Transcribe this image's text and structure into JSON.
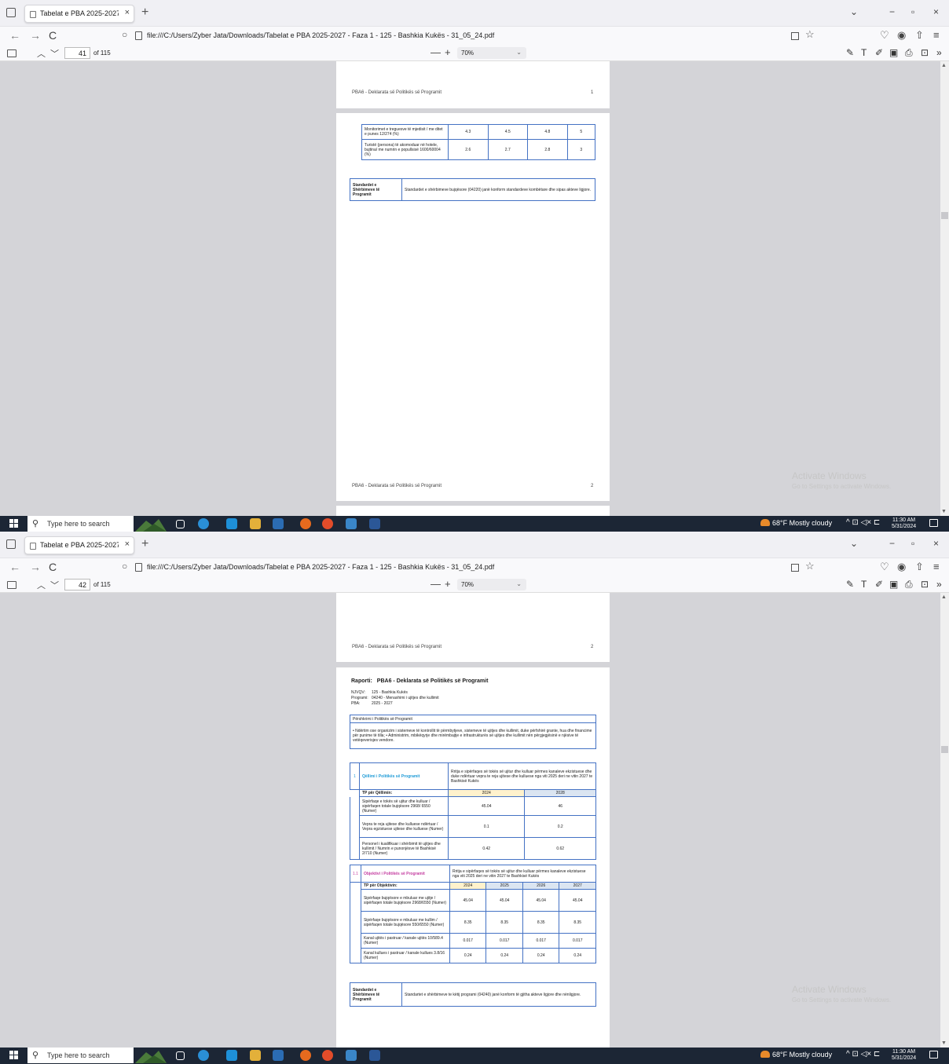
{
  "browser": {
    "tab_title": "Tabelat e PBA 2025-2027 - Faza 1 - 1",
    "tab_close": "×",
    "new_tab": "+",
    "url": "file:///C:/Users/Zyber Jata/Downloads/Tabelat e PBA 2025-2027 - Faza 1 - 125 - Bashkia Kukës - 31_05_24.pdf",
    "win_min": "−",
    "win_max": "▫",
    "win_close": "×",
    "list_all": "⌄",
    "back": "←",
    "forward": "→",
    "reload": "C"
  },
  "pdf_toolbar": {
    "total": "of 115",
    "zoom": "70%",
    "zoom_out": "—",
    "zoom_in": "+"
  },
  "screens": [
    {
      "page_number": "41"
    },
    {
      "page_number": "42"
    }
  ],
  "page_footer_label": "PBA6 - Deklarata së Politikës së Programit",
  "shot1": {
    "header_page_num": "1",
    "footer_page_num": "2",
    "indicator_rows": [
      {
        "label": "Monitorimet e treguesve të mjedisit / me ditet e punes 12/274 (%)",
        "v": [
          "4.3",
          "4.5",
          "4.8",
          "5"
        ]
      },
      {
        "label": "Turistë (persona) të akomoduar në hotele, bujtina/ me numrin e popullsisë 1600/60004 (%)",
        "v": [
          "2.6",
          "2.7",
          "2.8",
          "3"
        ]
      }
    ],
    "std_label": "Standardet e Shërbimeve të Programit",
    "std_text": "Standardet e shërbimeve bujqësore (04220) janë konform standardeve kombëtare dhe sipas akteve ligjore."
  },
  "shot2": {
    "header_page_num": "2",
    "report_label": "Raporti:",
    "report_title": "PBA6 - Deklarata së Politikës së Programit",
    "meta": [
      {
        "k": "NJVQV:",
        "v": "125 - Bashkia Kukës"
      },
      {
        "k": "Programi:",
        "v": "04240 - Menaxhimi i ujitjes dhe kullimit"
      },
      {
        "k": "PBA:",
        "v": "2025 - 2027"
      }
    ],
    "overview_title": "Përshkrimi i Politikës së Programit",
    "overview_text": "• Ndërtim ose organizim i sistemeve të kontrollit të përmbytjeve, sistemeve të ujitjes dhe kullimit, duke përfshirë grante, hua dhe financime për punime të tilla; • Administrim, mbikëqyrje dhe mirëmbajtje e infrastrukturës së ujitjes dhe kullimit nën përgjegjësinë e njësive të vetëqeverisjes vendore.",
    "goal_num": "1",
    "goal_label": "Qëllimi i Politikës së Programit",
    "goal_text": "Rritja e sipërfaqes së tokës së ujitur dhe kulluar përmes kanaleve ekzistuese dhe duke ndërtuar vepra te reja ujitese dhe kulluese nga viti 2025 deri ne vitin 2027 te Bashkisë Kukës",
    "tp_goal": "TP për Qëllimin:",
    "goal_years": [
      "2024",
      "2028"
    ],
    "goal_rows": [
      {
        "label": "Sipërfaqe e tokës së ujitur dhe kulluar / sipërfaqen totale bujqësore 2968/ 6550 (Numer)",
        "v": [
          "45.04",
          "46"
        ]
      },
      {
        "label": "Vepra te reja ujitese dhe kulluese ndërtuar / Vepra egzistuese ujitese dhe kulluese (Numer)",
        "v": [
          "0.1",
          "0.2"
        ]
      },
      {
        "label": "Personel i kualifikuar i shërbimit të ujitjes dhe kullimit / Numrin e punonjësve të Bashkisë 2/710 (Numer)",
        "v": [
          "0.42",
          "0.62"
        ]
      }
    ],
    "obj_num": "1.1",
    "obj_label": "Objektivi i Politikës së Programit",
    "obj_text": "Rritja e sipërfaqes së tokës së ujitur dhe kulluar përmes kanaleve ekzistuese nga viti 2025 deri ne vitin 2027 te Bashkisë Kukës",
    "tp_obj": "TP për Objektivin:",
    "obj_years": [
      "2024",
      "2025",
      "2026",
      "2027"
    ],
    "obj_rows": [
      {
        "label": "Sipërfaqe bujqësore e mbuluar me ujitje / sipërfaqen totale bujqësore 2968/6550 (Numer)",
        "v": [
          "45.04",
          "45.04",
          "45.04",
          "45.04"
        ]
      },
      {
        "label": "Sipërfaqe bujqësore e mbuluar me kullim / sipërfaqen totale bujqësore 550/6550 (Numer)",
        "v": [
          "8.35",
          "8.35",
          "8.35",
          "8.35"
        ]
      },
      {
        "label": "Kanal ujitës i pastruar / kanale ujitës 10/589.4 (Numer)",
        "v": [
          "0.017",
          "0.017",
          "0.017",
          "0.017"
        ]
      },
      {
        "label": "Kanal kullues i pastruar / kanale kullues 3.8/16 (Numer)",
        "v": [
          "0.24",
          "0.24",
          "0.24",
          "0.24"
        ]
      }
    ],
    "std_label": "Standardet e Shërbimeve të Programit",
    "std_text": "Standartet e shërbimeve te këtij programi (04240) janë konform të gjitha akteve ligjore dhe nënligjore."
  },
  "watermark": {
    "title": "Activate Windows",
    "sub": "Go to Settings to activate Windows."
  },
  "taskbar": {
    "search_placeholder": "Type here to search",
    "weather": "68°F  Mostly cloudy",
    "tray": "^  ⊡  ◁×  ⊏",
    "time": "11:30 AM",
    "date": "5/31/2024"
  },
  "colors": {
    "accent_blue": "#4472c4",
    "goal_blue": "#1f9bd7",
    "obj_pink": "#c43da0",
    "viewer_bg": "#d4d4d8",
    "taskbar": "#1c2635"
  }
}
